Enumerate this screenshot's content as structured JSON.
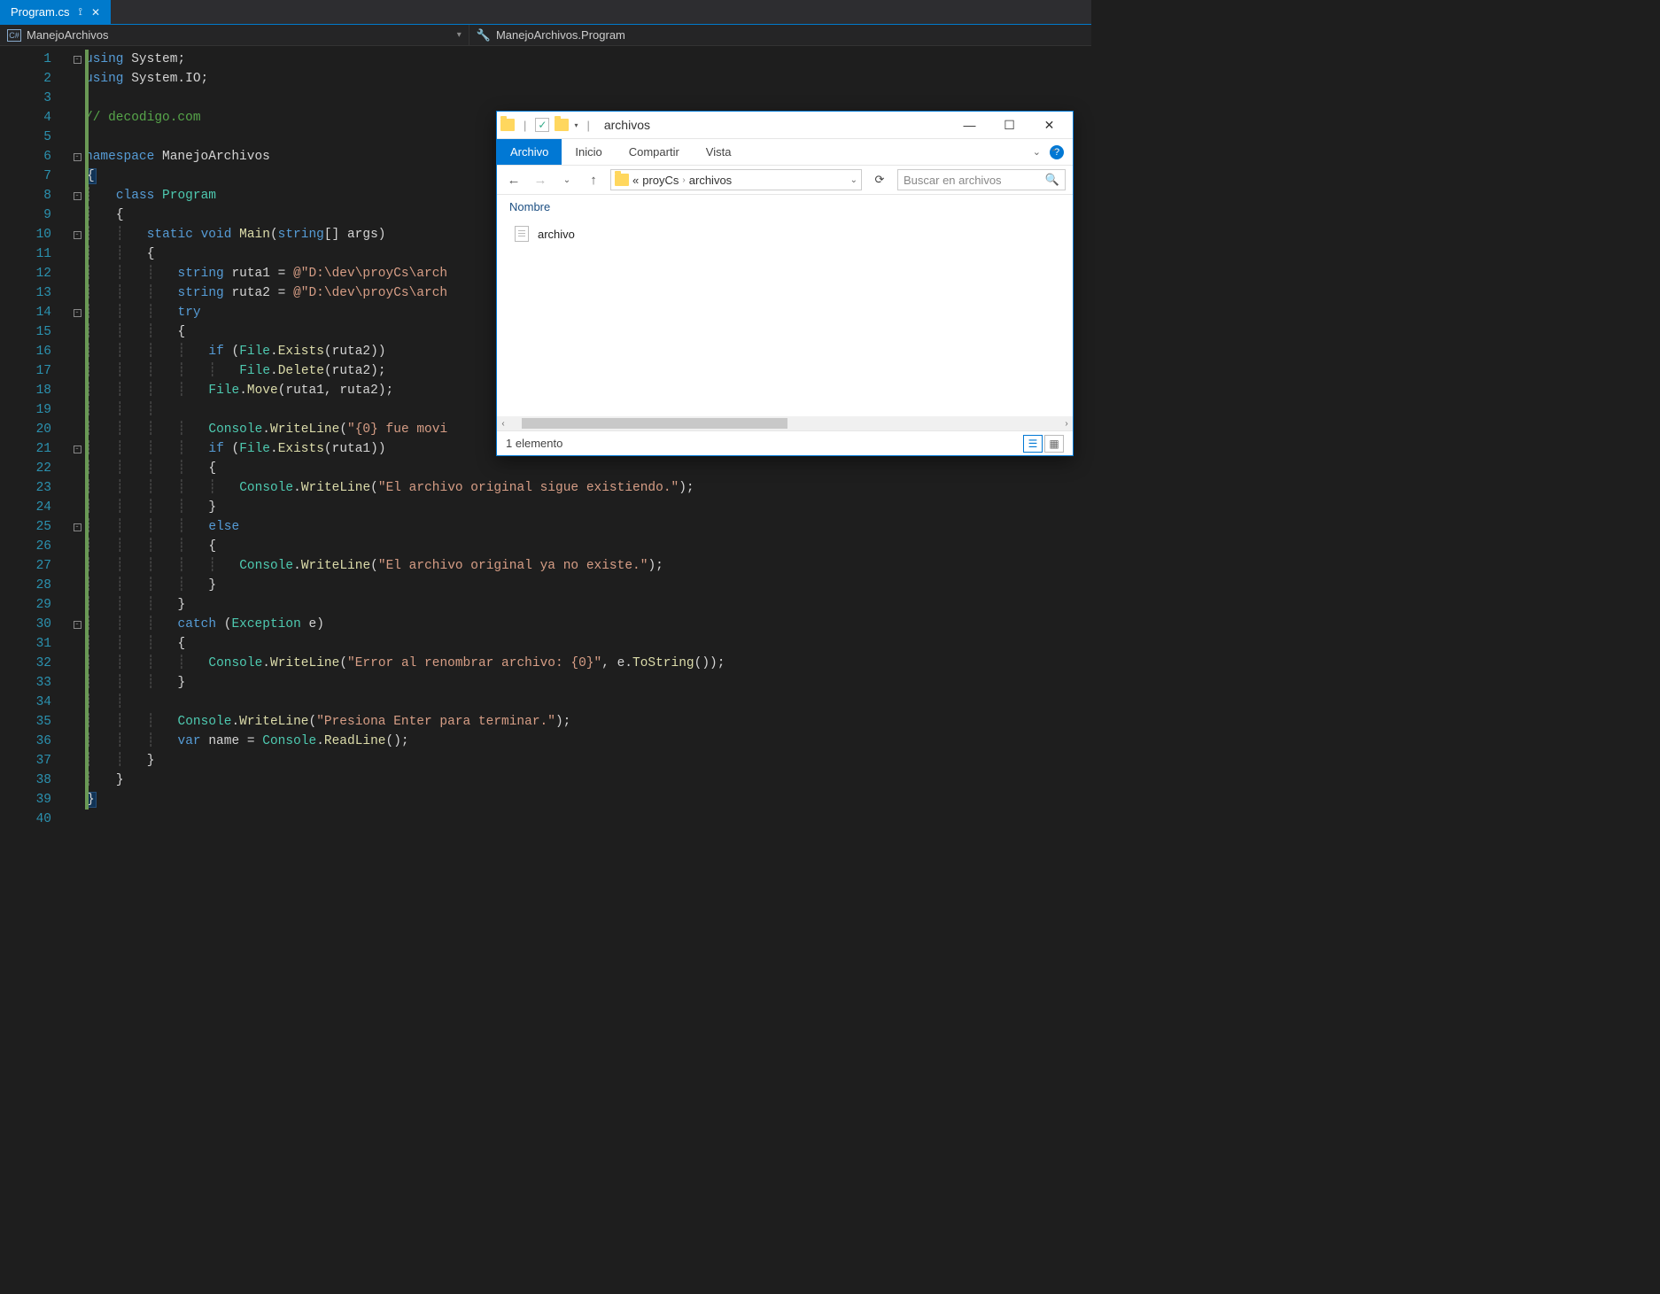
{
  "tab": {
    "filename": "Program.cs"
  },
  "nav": {
    "project": "ManejoArchivos",
    "member": "ManejoArchivos.Program"
  },
  "code": {
    "lines": [
      {
        "n": 1,
        "fold": "-",
        "tokens": [
          [
            "kw",
            "using"
          ],
          [
            "id",
            " System"
          ],
          [
            "pun",
            ";"
          ]
        ]
      },
      {
        "n": 2,
        "fold": "|",
        "tokens": [
          [
            "kw",
            "using"
          ],
          [
            "id",
            " System.IO"
          ],
          [
            "pun",
            ";"
          ]
        ]
      },
      {
        "n": 3,
        "tokens": []
      },
      {
        "n": 4,
        "tokens": [
          [
            "cmt",
            "// decodigo.com"
          ]
        ]
      },
      {
        "n": 5,
        "tokens": []
      },
      {
        "n": 6,
        "fold": "-",
        "tokens": [
          [
            "kw",
            "namespace"
          ],
          [
            "id",
            " ManejoArchivos"
          ]
        ]
      },
      {
        "n": 7,
        "tokens": [
          [
            "pun",
            "{"
          ]
        ],
        "brace": true
      },
      {
        "n": 8,
        "fold": "-",
        "indent": 1,
        "tokens": [
          [
            "kw",
            "class"
          ],
          [
            "typ",
            " Program"
          ]
        ]
      },
      {
        "n": 9,
        "indent": 1,
        "tokens": [
          [
            "pun",
            "{"
          ]
        ]
      },
      {
        "n": 10,
        "fold": "-",
        "indent": 2,
        "tokens": [
          [
            "kw",
            "static"
          ],
          [
            "kw",
            " void"
          ],
          [
            "mth",
            " Main"
          ],
          [
            "pun",
            "("
          ],
          [
            "kw",
            "string"
          ],
          [
            "pun",
            "[] "
          ],
          [
            "id",
            "args"
          ],
          [
            "pun",
            ")"
          ]
        ]
      },
      {
        "n": 11,
        "indent": 2,
        "tokens": [
          [
            "pun",
            "{"
          ]
        ]
      },
      {
        "n": 12,
        "indent": 3,
        "tokens": [
          [
            "kw",
            "string"
          ],
          [
            "id",
            " ruta1 "
          ],
          [
            "pun",
            "= "
          ],
          [
            "str",
            "@\"D:\\dev\\proyCs\\arch"
          ]
        ]
      },
      {
        "n": 13,
        "indent": 3,
        "tokens": [
          [
            "kw",
            "string"
          ],
          [
            "id",
            " ruta2 "
          ],
          [
            "pun",
            "= "
          ],
          [
            "str",
            "@\"D:\\dev\\proyCs\\arch"
          ]
        ]
      },
      {
        "n": 14,
        "fold": "-",
        "indent": 3,
        "tokens": [
          [
            "kw",
            "try"
          ]
        ]
      },
      {
        "n": 15,
        "indent": 3,
        "tokens": [
          [
            "pun",
            "{"
          ]
        ]
      },
      {
        "n": 16,
        "indent": 4,
        "tokens": [
          [
            "kw",
            "if"
          ],
          [
            "pun",
            " ("
          ],
          [
            "typ",
            "File"
          ],
          [
            "pun",
            "."
          ],
          [
            "mth",
            "Exists"
          ],
          [
            "pun",
            "(ruta2))"
          ]
        ]
      },
      {
        "n": 17,
        "indent": 5,
        "tokens": [
          [
            "typ",
            "File"
          ],
          [
            "pun",
            "."
          ],
          [
            "mth",
            "Delete"
          ],
          [
            "pun",
            "(ruta2);"
          ]
        ]
      },
      {
        "n": 18,
        "indent": 4,
        "tokens": [
          [
            "typ",
            "File"
          ],
          [
            "pun",
            "."
          ],
          [
            "mth",
            "Move"
          ],
          [
            "pun",
            "(ruta1, ruta2);"
          ]
        ]
      },
      {
        "n": 19,
        "indent": 3,
        "tokens": []
      },
      {
        "n": 20,
        "indent": 4,
        "tokens": [
          [
            "typ",
            "Console"
          ],
          [
            "pun",
            "."
          ],
          [
            "mth",
            "WriteLine"
          ],
          [
            "pun",
            "("
          ],
          [
            "str",
            "\"{0} fue movi"
          ]
        ]
      },
      {
        "n": 21,
        "fold": "-",
        "indent": 4,
        "tokens": [
          [
            "kw",
            "if"
          ],
          [
            "pun",
            " ("
          ],
          [
            "typ",
            "File"
          ],
          [
            "pun",
            "."
          ],
          [
            "mth",
            "Exists"
          ],
          [
            "pun",
            "(ruta1))"
          ]
        ]
      },
      {
        "n": 22,
        "indent": 4,
        "tokens": [
          [
            "pun",
            "{"
          ]
        ]
      },
      {
        "n": 23,
        "indent": 5,
        "tokens": [
          [
            "typ",
            "Console"
          ],
          [
            "pun",
            "."
          ],
          [
            "mth",
            "WriteLine"
          ],
          [
            "pun",
            "("
          ],
          [
            "str",
            "\"El archivo original sigue existiendo.\""
          ],
          [
            "pun",
            ");"
          ]
        ]
      },
      {
        "n": 24,
        "indent": 4,
        "tokens": [
          [
            "pun",
            "}"
          ]
        ]
      },
      {
        "n": 25,
        "fold": "-",
        "indent": 4,
        "tokens": [
          [
            "kw",
            "else"
          ]
        ]
      },
      {
        "n": 26,
        "indent": 4,
        "tokens": [
          [
            "pun",
            "{"
          ]
        ]
      },
      {
        "n": 27,
        "indent": 5,
        "tokens": [
          [
            "typ",
            "Console"
          ],
          [
            "pun",
            "."
          ],
          [
            "mth",
            "WriteLine"
          ],
          [
            "pun",
            "("
          ],
          [
            "str",
            "\"El archivo original ya no existe.\""
          ],
          [
            "pun",
            ");"
          ]
        ]
      },
      {
        "n": 28,
        "indent": 4,
        "tokens": [
          [
            "pun",
            "}"
          ]
        ]
      },
      {
        "n": 29,
        "indent": 3,
        "tokens": [
          [
            "pun",
            "}"
          ]
        ]
      },
      {
        "n": 30,
        "fold": "-",
        "indent": 3,
        "tokens": [
          [
            "kw",
            "catch"
          ],
          [
            "pun",
            " ("
          ],
          [
            "typ",
            "Exception"
          ],
          [
            "id",
            " e"
          ],
          [
            "pun",
            ")"
          ]
        ]
      },
      {
        "n": 31,
        "indent": 3,
        "tokens": [
          [
            "pun",
            "{"
          ]
        ]
      },
      {
        "n": 32,
        "indent": 4,
        "tokens": [
          [
            "typ",
            "Console"
          ],
          [
            "pun",
            "."
          ],
          [
            "mth",
            "WriteLine"
          ],
          [
            "pun",
            "("
          ],
          [
            "str",
            "\"Error al renombrar archivo: {0}\""
          ],
          [
            "pun",
            ", e."
          ],
          [
            "mth",
            "ToString"
          ],
          [
            "pun",
            "());"
          ]
        ]
      },
      {
        "n": 33,
        "indent": 3,
        "tokens": [
          [
            "pun",
            "}"
          ]
        ]
      },
      {
        "n": 34,
        "indent": 2,
        "tokens": []
      },
      {
        "n": 35,
        "indent": 3,
        "tokens": [
          [
            "typ",
            "Console"
          ],
          [
            "pun",
            "."
          ],
          [
            "mth",
            "WriteLine"
          ],
          [
            "pun",
            "("
          ],
          [
            "str",
            "\"Presiona Enter para terminar.\""
          ],
          [
            "pun",
            ");"
          ]
        ]
      },
      {
        "n": 36,
        "indent": 3,
        "tokens": [
          [
            "kw",
            "var"
          ],
          [
            "id",
            " name "
          ],
          [
            "pun",
            "= "
          ],
          [
            "typ",
            "Console"
          ],
          [
            "pun",
            "."
          ],
          [
            "mth",
            "ReadLine"
          ],
          [
            "pun",
            "();"
          ]
        ]
      },
      {
        "n": 37,
        "indent": 2,
        "tokens": [
          [
            "pun",
            "}"
          ]
        ]
      },
      {
        "n": 38,
        "indent": 1,
        "tokens": [
          [
            "pun",
            "}"
          ]
        ]
      },
      {
        "n": 39,
        "tokens": [
          [
            "pun",
            "}"
          ]
        ],
        "brace": true
      },
      {
        "n": 40,
        "tokens": []
      }
    ]
  },
  "explorer": {
    "title": "archivos",
    "tabs": {
      "file": "Archivo",
      "home": "Inicio",
      "share": "Compartir",
      "view": "Vista"
    },
    "path": {
      "ellipsis": "«",
      "seg1": "proyCs",
      "seg2": "archivos"
    },
    "search_placeholder": "Buscar en archivos",
    "column_name": "Nombre",
    "files": [
      {
        "name": "archivo"
      }
    ],
    "status": "1 elemento"
  }
}
